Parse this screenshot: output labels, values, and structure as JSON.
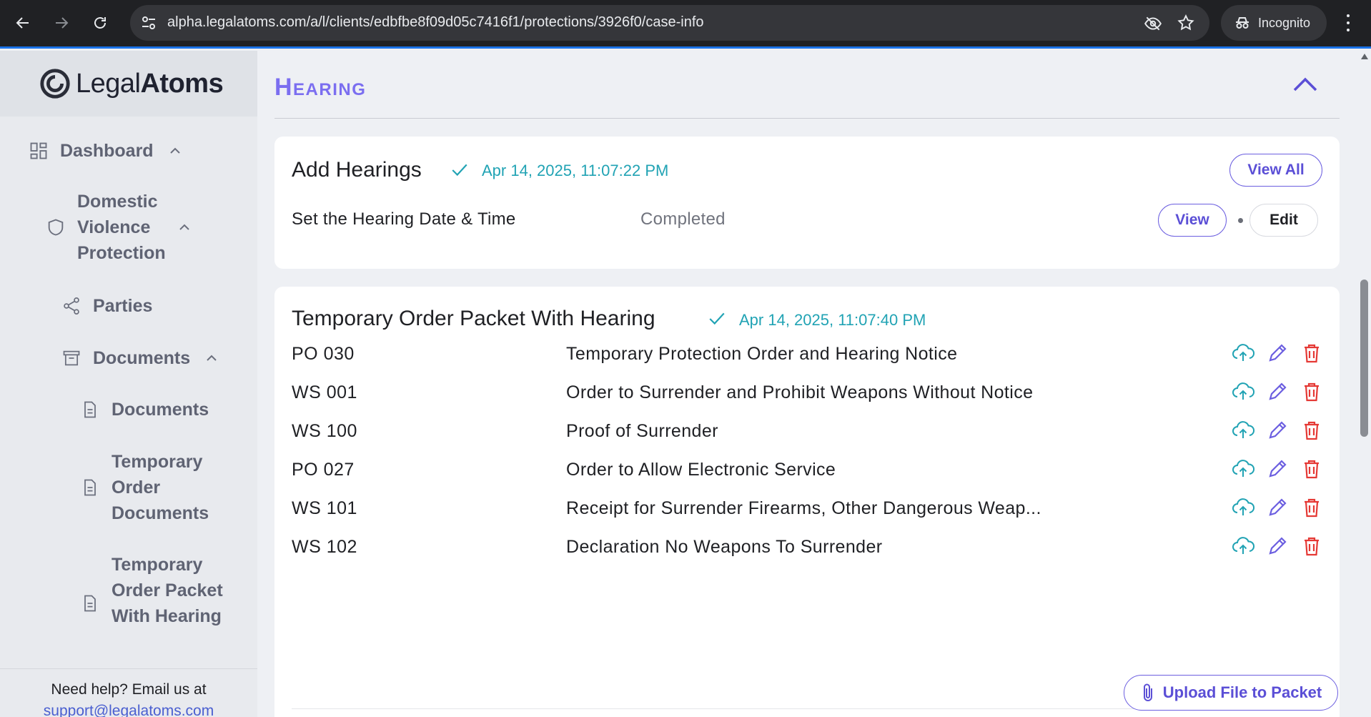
{
  "browser": {
    "url": "alpha.legalatoms.com/a/l/clients/edbfbe8f09d05c7416f1/protections/3926f0/case-info",
    "incognito_label": "Incognito"
  },
  "sidebar": {
    "brand_light": "Legal",
    "brand_bold": "Atoms",
    "items": [
      {
        "label": "Dashboard"
      },
      {
        "label": "Domestic Violence Protection"
      },
      {
        "label": "Parties"
      },
      {
        "label": "Documents"
      },
      {
        "label": "Documents"
      },
      {
        "label": "Temporary Order Documents"
      },
      {
        "label": "Temporary Order Packet With Hearing"
      }
    ],
    "help_text": "Need help? Email us at",
    "help_email": "support@legalatoms.com"
  },
  "main": {
    "section_title": "Hearing",
    "add_hearings": {
      "title": "Add Hearings",
      "timestamp": "Apr 14, 2025, 11:07:22 PM",
      "view_all_label": "View All",
      "task_label": "Set the Hearing Date & Time",
      "task_status": "Completed",
      "view_label": "View",
      "edit_label": "Edit"
    },
    "packet": {
      "title": "Temporary Order Packet With Hearing",
      "timestamp": "Apr 14, 2025, 11:07:40 PM",
      "documents": [
        {
          "code": "PO 030",
          "name": "Temporary Protection Order and Hearing Notice"
        },
        {
          "code": "WS 001",
          "name": "Order to Surrender and Prohibit Weapons Without Notice"
        },
        {
          "code": "WS 100",
          "name": "Proof of Surrender"
        },
        {
          "code": "PO 027",
          "name": "Order to Allow Electronic Service"
        },
        {
          "code": "WS 101",
          "name": "Receipt for Surrender Firearms, Other Dangerous Weap..."
        },
        {
          "code": "WS 102",
          "name": "Declaration No Weapons To Surrender"
        }
      ],
      "upload_label": "Upload File to Packet"
    }
  },
  "colors": {
    "accent": "#6c5fe0",
    "teal": "#21a3b4",
    "danger": "#e53935"
  }
}
